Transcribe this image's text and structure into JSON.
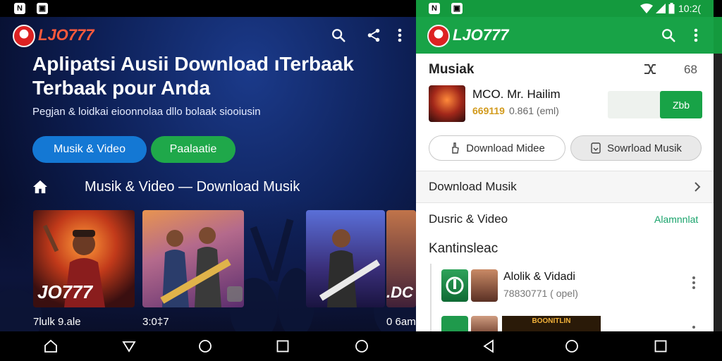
{
  "left": {
    "status_icons": [
      "N",
      "▣"
    ],
    "app_name": "LJO777",
    "hero": {
      "title_line1": "Aplipatsi Ausii Download ıTerbaak",
      "title_line2": "Terbaak pour Anda",
      "subtitle": "Pegjan & loidkai eioonnolaa dllo bolaak siooiusin"
    },
    "chips": [
      "Musik & Video",
      "Paalaatie"
    ],
    "section_label": "Musik & Video — Download Musik",
    "cards": [
      {
        "caption": "JO777",
        "label": "7lulk 9.ale"
      },
      {
        "caption": "",
        "label": "3:0‡7"
      },
      {
        "caption": "",
        "label": ""
      },
      {
        "caption": ".DC",
        "label": "0 6am"
      }
    ]
  },
  "right": {
    "status_time": "10:2(",
    "app_name": "LJO777",
    "section_title": "Musiak",
    "section_counter": "68",
    "track": {
      "title": "MCO. Mr. Hailim",
      "meta_digits": "669119",
      "meta_rating": "0.861 (eml)",
      "action_label": "Zbb"
    },
    "buttons": {
      "download_video": "Download Midee",
      "download_music": "Sowrload Musik"
    },
    "menu": [
      {
        "label": "Download Musik"
      },
      {
        "label": "Dusric & Video",
        "action": "Alamnnlat"
      }
    ],
    "list_heading": "Kantinsleac",
    "list_items": [
      {
        "title": "Alolik & Vidadi",
        "meta": "78830771 ( opel)"
      },
      {
        "banner": "BOONITLIN"
      }
    ]
  },
  "colors": {
    "green": "#18a347",
    "blue_chip": "#1478d4",
    "brand_red": "#ff5a3c",
    "teal_link": "#19a36b"
  }
}
